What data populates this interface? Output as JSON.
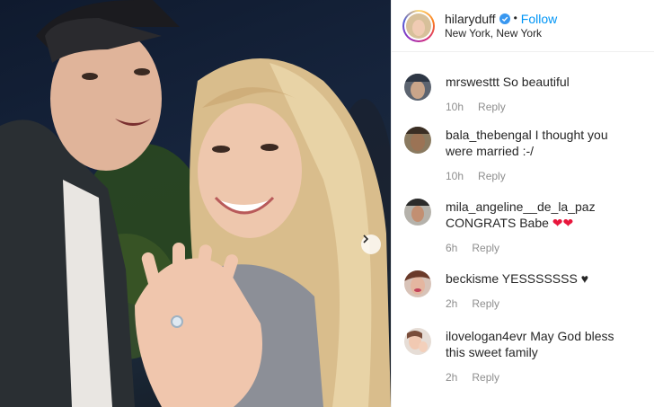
{
  "post": {
    "username": "hilaryduff",
    "dot": "•",
    "follow_label": "Follow",
    "location": "New York, New York"
  },
  "comments": [
    {
      "user": "mrswesttt",
      "text": "So beautiful",
      "time": "10h",
      "reply": "Reply"
    },
    {
      "user": "bala_thebengal",
      "text": "I thought you were married :-/",
      "time": "10h",
      "reply": "Reply"
    },
    {
      "user": "mila_angeline__de_la_paz",
      "text": "CONGRATS Babe",
      "emoji": "❤❤",
      "time": "6h",
      "reply": "Reply"
    },
    {
      "user": "beckisme",
      "text": "YESSSSSSS ♥",
      "time": "2h",
      "reply": "Reply"
    },
    {
      "user": "ilovelogan4evr",
      "text": "May God bless this sweet family",
      "time": "2h",
      "reply": "Reply"
    }
  ],
  "colors": {
    "accent": "#0095f6",
    "muted": "#8e8e8e",
    "heart": "#e8163c"
  }
}
